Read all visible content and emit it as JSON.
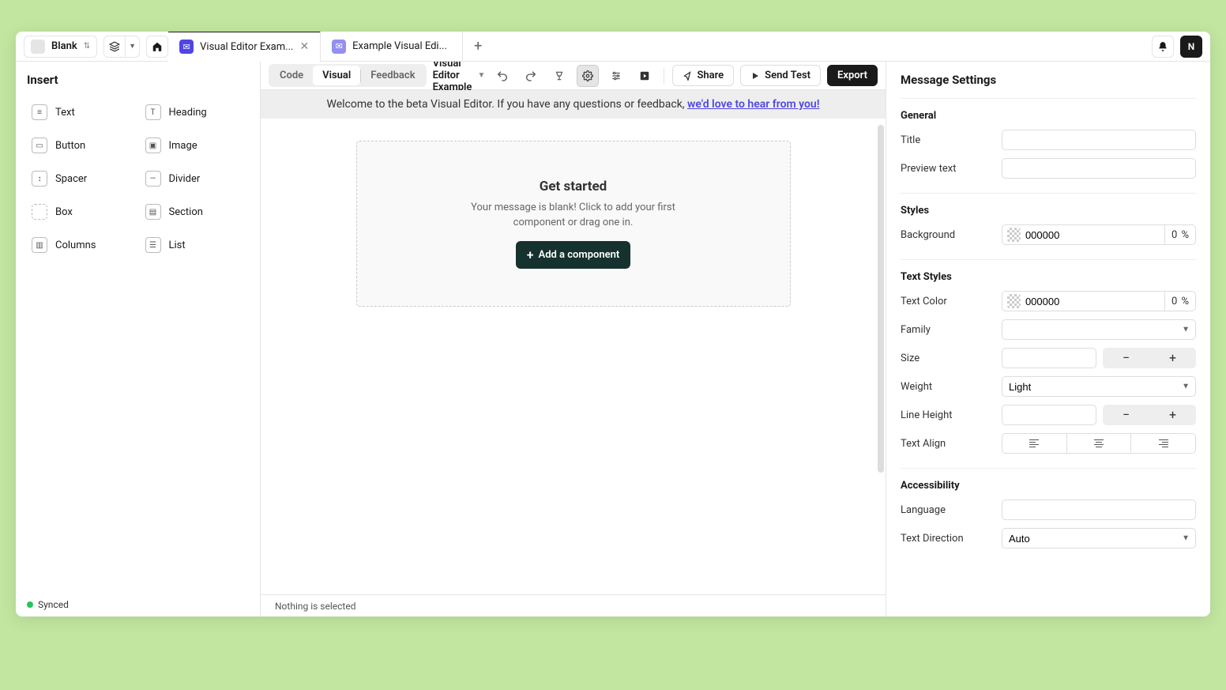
{
  "titlebar": {
    "project_name": "Blank",
    "avatar_initial": "N"
  },
  "tabs": [
    {
      "label": "Visual Editor Exam...",
      "active": true
    },
    {
      "label": "Example Visual Edi...",
      "active": false
    }
  ],
  "left": {
    "title": "Insert",
    "items": [
      "Text",
      "Heading",
      "Button",
      "Image",
      "Spacer",
      "Divider",
      "Box",
      "Section",
      "Columns",
      "List"
    ],
    "status": "Synced"
  },
  "toolbar": {
    "modes": {
      "code": "Code",
      "visual": "Visual",
      "feedback": "Feedback"
    },
    "doc_title": "Visual Editor Example",
    "share": "Share",
    "send_test": "Send Test",
    "export": "Export"
  },
  "banner": {
    "text": "Welcome to the beta Visual Editor. If you have any questions or feedback, ",
    "link": "we'd love to hear from you!"
  },
  "canvas": {
    "title": "Get started",
    "subtitle": "Your message is blank! Click to add your first component or drag one in.",
    "button": "Add a component"
  },
  "footer": {
    "selection": "Nothing is selected"
  },
  "settings": {
    "title": "Message Settings",
    "general": {
      "heading": "General",
      "title_label": "Title",
      "preview_label": "Preview text"
    },
    "styles": {
      "heading": "Styles",
      "background_label": "Background",
      "background_hex": "000000",
      "background_pct": "0"
    },
    "text": {
      "heading": "Text Styles",
      "color_label": "Text Color",
      "color_hex": "000000",
      "color_pct": "0",
      "family_label": "Family",
      "size_label": "Size",
      "weight_label": "Weight",
      "weight_value": "Light",
      "lh_label": "Line Height",
      "align_label": "Text Align"
    },
    "a11y": {
      "heading": "Accessibility",
      "lang_label": "Language",
      "dir_label": "Text Direction",
      "dir_value": "Auto"
    }
  }
}
